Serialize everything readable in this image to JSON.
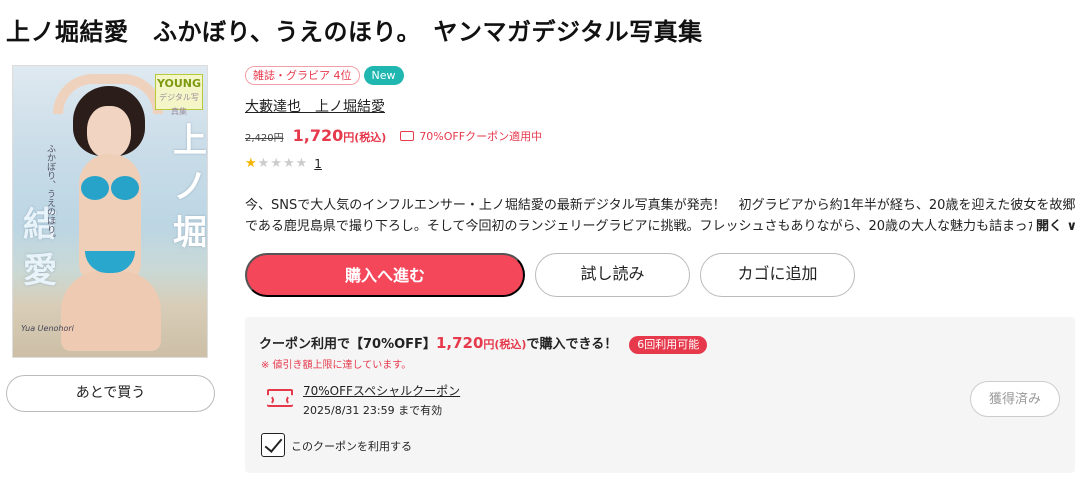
{
  "product": {
    "title": "上ノ堀結愛　ふかぼり、うえのほり。　ヤンマガデジタル写真集",
    "rank_badge": "雑誌・グラビア 4位",
    "new_badge": "New",
    "authors": "大藪達也　上ノ堀結愛",
    "old_price": "2,420円",
    "new_price": "1,720",
    "price_suffix": "円(税込)",
    "coupon_applied": "70%OFFクーポン適用中",
    "rating_stars": 1,
    "review_count": "1",
    "description_line1": "今、SNSで大人気のインフルエンサー・上ノ堀結愛の最新デジタル写真集が発売！　初グラビアから約1年半が経ち、20歳を迎えた彼女を故郷",
    "description_line2": "である鹿児島県で撮り下ろし。そして今回初のランジェリーグラビアに挑戦。フレッシュさもありながら、20歳の大人な魅力も詰まった",
    "open_label": "開く ∨"
  },
  "cover": {
    "logo_text": "YOUNG",
    "logo_sub": "デジタル写真集",
    "vertical_right": "上ノ堀",
    "vertical_left": "結愛",
    "small_vertical": "ふかぼり、うえのほり。",
    "romaji": "Yua Uenohori"
  },
  "buttons": {
    "later": "あとで買う",
    "buy": "購入へ進む",
    "trial": "試し読み",
    "cart": "カゴに追加"
  },
  "coupon": {
    "head_prefix": "クーポン利用で【70%OFF】",
    "head_price": "1,720",
    "head_price_suffix": "円(税込)",
    "head_tail": "で購入できる！",
    "uses_badge": "6回利用可能",
    "warning": "※ 値引き額上限に達しています。",
    "name": "70%OFFスペシャルクーポン",
    "expiry": "2025/8/31 23:59 まで有効",
    "acquired_label": "獲得済み",
    "use_checkbox_label": "このクーポンを利用する",
    "use_checked": true
  },
  "colors": {
    "accent_red": "#e6394c",
    "buy_button": "#f4475a",
    "new_badge": "#1fb7b0",
    "star_on": "#f4b400"
  }
}
